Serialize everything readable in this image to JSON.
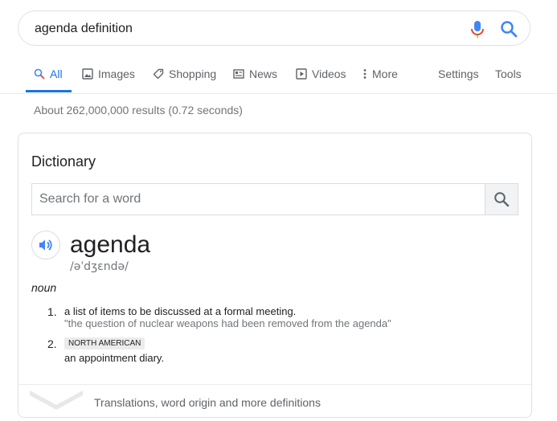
{
  "search": {
    "query": "agenda definition"
  },
  "tabs": [
    {
      "label": "All",
      "icon": "search-icon"
    },
    {
      "label": "Images",
      "icon": "image-icon"
    },
    {
      "label": "Shopping",
      "icon": "tag-icon"
    },
    {
      "label": "News",
      "icon": "newspaper-icon"
    },
    {
      "label": "Videos",
      "icon": "play-icon"
    },
    {
      "label": "More",
      "icon": "more-vert-icon"
    }
  ],
  "tools": {
    "settings": "Settings",
    "tools": "Tools"
  },
  "result_stats": "About 262,000,000 results (0.72 seconds)",
  "dictionary": {
    "title": "Dictionary",
    "search_placeholder": "Search for a word",
    "word": "agenda",
    "phonetic": "/əˈdʒɛndə/",
    "part_of_speech": "noun",
    "senses": [
      {
        "number": "1.",
        "definition": "a list of items to be discussed at a formal meeting.",
        "example": "\"the question of nuclear weapons had been removed from the agenda\""
      },
      {
        "number": "2.",
        "region": "NORTH AMERICAN",
        "definition": "an appointment diary."
      }
    ],
    "footer": "Translations, word origin and more definitions"
  },
  "colors": {
    "accent": "#1a73e8",
    "text": "#202124",
    "muted": "#70757a"
  }
}
